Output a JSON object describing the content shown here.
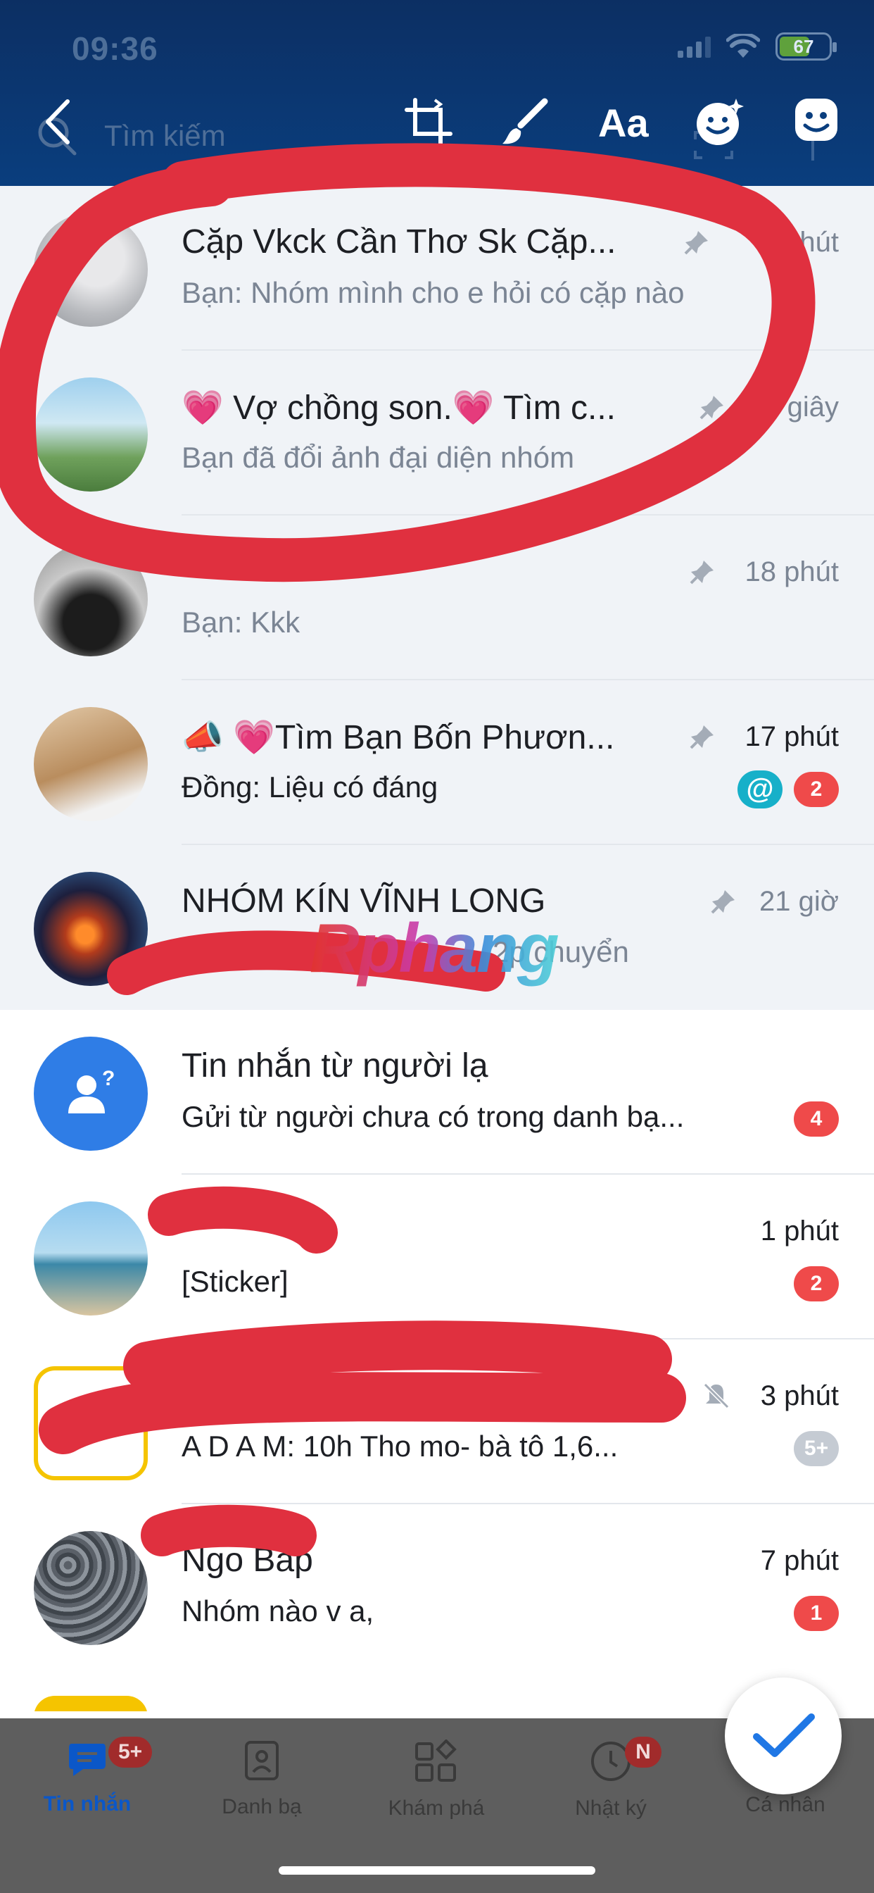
{
  "status": {
    "time": "09:36",
    "battery": "67"
  },
  "toolbar": {
    "search_placeholder": "Tìm kiếm",
    "text_tool_label": "Aa"
  },
  "conversations": [
    {
      "title": "Cặp Vkck Cần Thơ Sk Cặp...",
      "preview": "Bạn: Nhóm mình cho e hỏi có cặp nào",
      "time": "phút",
      "pinned": true
    },
    {
      "title": "Vợ chồng son.",
      "title_suffix": "Tìm c...",
      "preview": "Bạn đã đổi ảnh đại diện nhóm",
      "time": "giây",
      "pinned": true
    },
    {
      "title": "",
      "preview": "Bạn: Kkk",
      "time": "18 phút",
      "pinned": true
    },
    {
      "title": "Tìm Bạn Bốn Phươn...",
      "preview": "Đồng: Liệu có đáng",
      "time": "17 phút",
      "pinned": true,
      "mention": "@",
      "unread": "2"
    },
    {
      "title": "NHÓM KÍN VĨNH LONG",
      "preview": "2p chuyển",
      "time": "21 giờ",
      "pinned": true
    },
    {
      "title": "Tin nhắn từ người lạ",
      "preview": "Gửi từ người chưa có trong danh bạ...",
      "time": "",
      "unread": "4"
    },
    {
      "title": "",
      "preview": "[Sticker]",
      "time": "1 phút",
      "unread": "2"
    },
    {
      "title": "",
      "preview": "A D A M: 10h Tho mo- bà tô 1,6...",
      "time": "3 phút",
      "muted": true,
      "unread": "5+"
    },
    {
      "title": "Ngo Bap",
      "preview": "Nhóm nào v a,",
      "time": "7 phút",
      "unread": "1"
    }
  ],
  "bottom_nav": [
    {
      "label": "Tin nhắn",
      "badge": "5+",
      "active": true
    },
    {
      "label": "Danh bạ"
    },
    {
      "label": "Khám phá"
    },
    {
      "label": "Nhật ký",
      "badge": "N"
    },
    {
      "label": "Cá nhân"
    }
  ],
  "watermark": "Rphang",
  "colors": {
    "header": "#0a3e7e",
    "accent": "#0b57c8",
    "badge": "#ef4a4a",
    "annotation": "#e0303f"
  }
}
